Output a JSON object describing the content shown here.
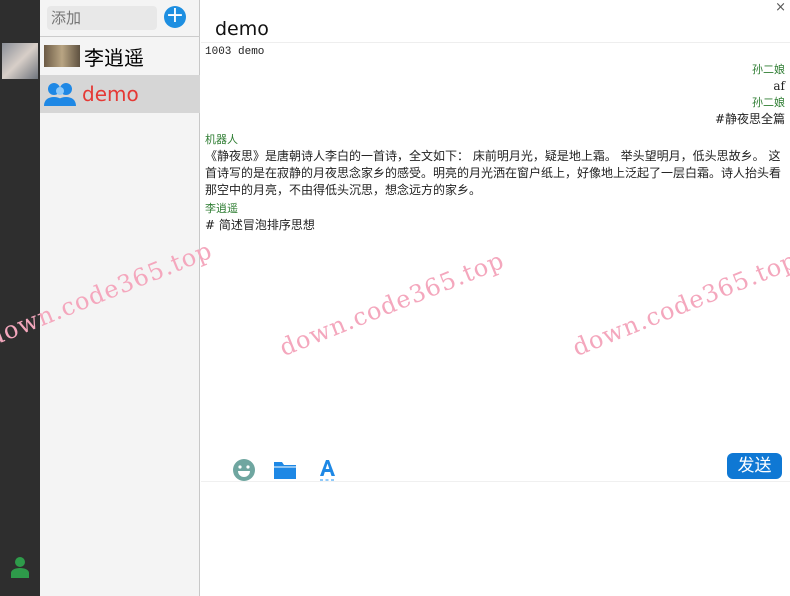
{
  "sidebar": {
    "search_placeholder": "添加",
    "add_label": "+"
  },
  "contacts": [
    {
      "name": "李逍遥"
    },
    {
      "name": "demo"
    }
  ],
  "chat": {
    "title": "demo",
    "close": "×",
    "system_line": "1003 demo",
    "messages": [
      {
        "sender": "孙二娘",
        "text": "af",
        "side": "right"
      },
      {
        "sender": "孙二娘",
        "text": "#静夜思全篇",
        "side": "right"
      },
      {
        "sender": "机器人",
        "text": "《静夜思》是唐朝诗人李白的一首诗，全文如下： 床前明月光，疑是地上霜。 举头望明月，低头思故乡。 这首诗写的是在寂静的月夜思念家乡的感受。明亮的月光洒在窗户纸上，好像地上泛起了一层白霜。诗人抬头看那空中的月亮，不由得低头沉思，想念远方的家乡。",
        "side": "left"
      },
      {
        "sender": "李逍遥",
        "text": "# 简述冒泡排序思想",
        "side": "left"
      }
    ],
    "send_label": "发送"
  },
  "watermark": "down.code365.top"
}
